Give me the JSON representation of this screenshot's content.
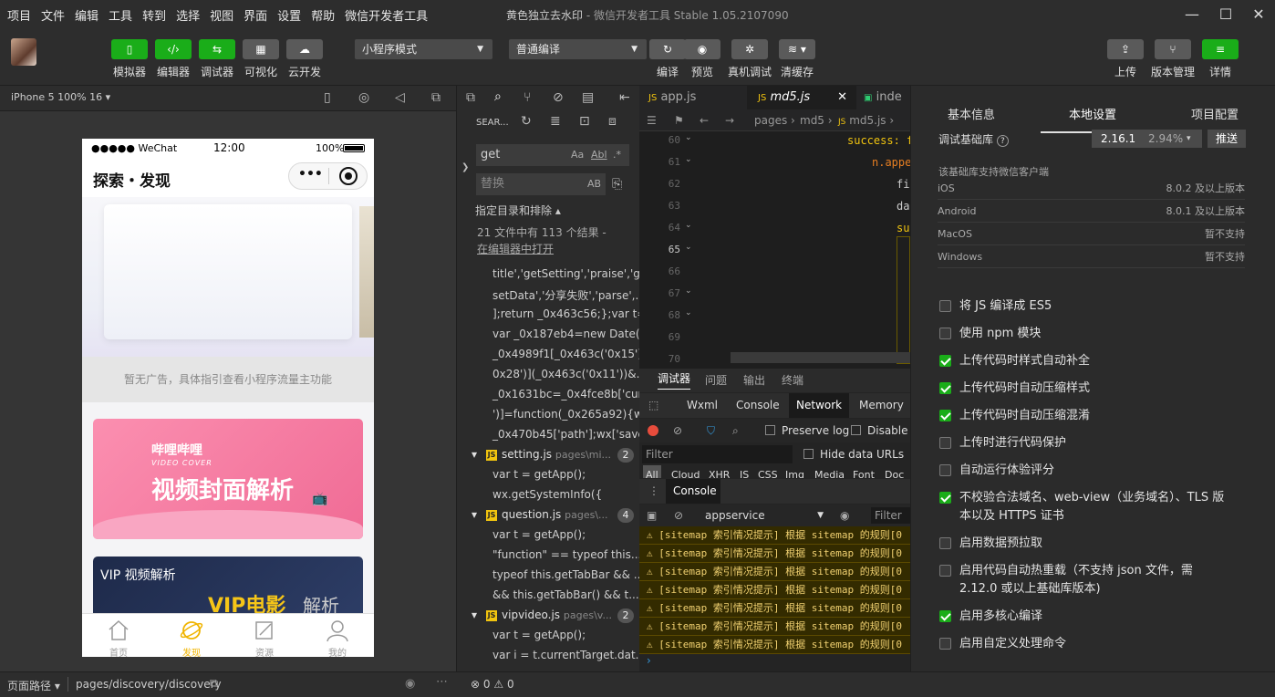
{
  "menubar": {
    "items": [
      "项目",
      "文件",
      "编辑",
      "工具",
      "转到",
      "选择",
      "视图",
      "界面",
      "设置",
      "帮助",
      "微信开发者工具"
    ],
    "title_project": "黄色独立去水印",
    "title_rest": " - 微信开发者工具 Stable 1.05.2107090"
  },
  "toolbar": {
    "simulator": "模拟器",
    "editor": "编辑器",
    "debugger": "调试器",
    "visual": "可视化",
    "cloud": "云开发",
    "mode_select": "小程序模式",
    "compile_select": "普通编译",
    "compile": "编译",
    "preview": "预览",
    "remote_debug": "真机调试",
    "clear_cache": "清缓存",
    "upload": "上传",
    "version": "版本管理",
    "details": "详情"
  },
  "simbar": {
    "device": "iPhone 5 100% 16"
  },
  "phone": {
    "status_dots": "●●●●● WeChat",
    "time": "12:00",
    "battery": "100%",
    "nav_title": "探索・发现",
    "ad_text": "暂无广告，具体指引查看小程序流量主功能",
    "banner1_brand": "哔哩哔哩",
    "banner1_sub": "VIDEO COVER",
    "banner1_title": "视频封面解析",
    "banner2_title": "VIP 视频解析",
    "banner2_big": "VIP电影",
    "banner2_small": "解析",
    "tabs": [
      "首页",
      "发现",
      "资源",
      "我的"
    ]
  },
  "footer": {
    "path_label": "页面路径",
    "path": "pages/discovery/discovery",
    "errors": "0",
    "warnings": "0"
  },
  "search": {
    "header": "SEAR...",
    "query": "get",
    "replace_placeholder": "替换",
    "scope": "指定目录和排除",
    "summary": "21 文件中有 113 个结果 -",
    "open_in_editor": "在编辑器中打开",
    "lines_top": [
      "title','getSetting','praise','g...",
      "setData','分享失败','parse',...",
      "];return _0x463c56;};var t=...",
      "var _0x187eb4=new Date(...",
      "_0x4989f1[_0x463c('0x15')...",
      "0x28')](_0x463c('0x11'))&...",
      "_0x1631bc=_0x4fce8b['cur...",
      "')]=function(_0x265a92){w...",
      "_0x470b45['path'];wx['save..."
    ],
    "file1": {
      "name": "setting.js",
      "path": "pages\\mi...",
      "count": "2",
      "lines": [
        "var t = getApp();",
        "wx.getSystemInfo({"
      ]
    },
    "file2": {
      "name": "question.js",
      "path": "pages\\...",
      "count": "4",
      "lines": [
        "var t = getApp();",
        "\"function\" == typeof this....",
        "typeof this.getTabBar && ...",
        "&& this.getTabBar() && t..."
      ]
    },
    "file3": {
      "name": "vipvideo.js",
      "path": "pages\\v...",
      "count": "2",
      "lines": [
        "var t = getApp();",
        "var i = t.currentTarget.dat..."
      ]
    }
  },
  "editor": {
    "tabs": [
      "app.js",
      "md5.js",
      "inde"
    ],
    "breadcrumb": [
      "pages",
      "md5",
      "md5.js"
    ],
    "line_numbers": [
      "60",
      "61",
      "62",
      "63",
      "64",
      "65",
      "66",
      "67",
      "68",
      "69",
      "70"
    ],
    "code_success": "success: f",
    "code_append": "n.appen",
    "code_fi": "fi",
    "code_da": "da",
    "code_su": "su"
  },
  "devtools": {
    "tabs": [
      "调试器",
      "问题",
      "输出",
      "终端"
    ],
    "panels": [
      "Wxml",
      "Console",
      "Network",
      "Memory"
    ],
    "preserve_log": "Preserve log",
    "disable_cache": "Disable c",
    "filter_placeholder": "Filter",
    "hide_data_urls": "Hide data URLs",
    "types": [
      "All",
      "Cloud",
      "XHR",
      "JS",
      "CSS",
      "Img",
      "Media",
      "Font",
      "Doc"
    ],
    "console_tab": "Console",
    "context": "appservice",
    "filter2": "Filter",
    "warning_line": "[sitemap 索引情况提示] 根据 sitemap 的规则[0"
  },
  "settings": {
    "tabs": [
      "基本信息",
      "本地设置",
      "项目配置"
    ],
    "lib_label": "调试基础库",
    "lib_version": "2.16.1",
    "lib_share": "2.94%",
    "push": "推送",
    "support_note": "该基础库支持微信客户端",
    "platforms": [
      {
        "name": "iOS",
        "value": "8.0.2 及以上版本"
      },
      {
        "name": "Android",
        "value": "8.0.1 及以上版本"
      },
      {
        "name": "MacOS",
        "value": "暂不支持"
      },
      {
        "name": "Windows",
        "value": "暂不支持"
      }
    ],
    "options": [
      {
        "label": "将 JS 编译成 ES5",
        "checked": false
      },
      {
        "label": "使用 npm 模块",
        "checked": false
      },
      {
        "label": "上传代码时样式自动补全",
        "checked": true
      },
      {
        "label": "上传代码时自动压缩样式",
        "checked": true
      },
      {
        "label": "上传代码时自动压缩混淆",
        "checked": true
      },
      {
        "label": "上传时进行代码保护",
        "checked": false
      },
      {
        "label": "自动运行体验评分",
        "checked": false
      },
      {
        "label": "不校验合法域名、web-view（业务域名）、TLS 版",
        "label2": "本以及 HTTPS 证书",
        "checked": true
      },
      {
        "label": "启用数据预拉取",
        "checked": false
      },
      {
        "label": "启用代码自动热重载（不支持 json 文件，需",
        "label2": "2.12.0 或以上基础库版本)",
        "checked": false
      },
      {
        "label": "启用多核心编译",
        "checked": true
      },
      {
        "label": "启用自定义处理命令",
        "checked": false
      }
    ]
  }
}
